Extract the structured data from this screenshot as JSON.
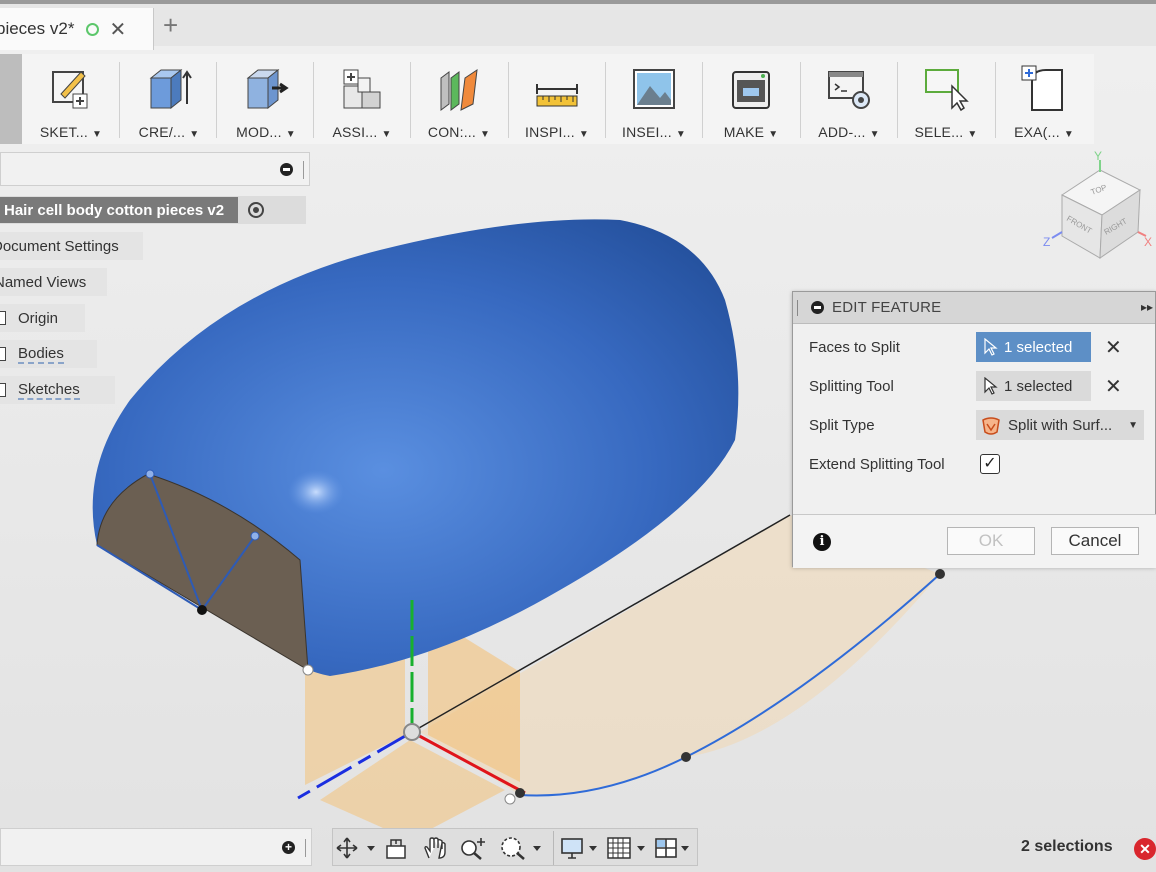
{
  "document_tab": {
    "title": "pieces v2*",
    "new_tab_icon": "plus-icon"
  },
  "toolbar": {
    "items": [
      {
        "label": "SKET...",
        "icon": "sketch-icon"
      },
      {
        "label": "CRE/...",
        "icon": "create-icon"
      },
      {
        "label": "MOD...",
        "icon": "modify-icon"
      },
      {
        "label": "ASSI...",
        "icon": "assemble-icon"
      },
      {
        "label": "CON:...",
        "icon": "construct-icon"
      },
      {
        "label": "INSPI...",
        "icon": "inspect-icon"
      },
      {
        "label": "INSEI...",
        "icon": "insert-icon"
      },
      {
        "label": "MAKE",
        "icon": "make-icon"
      },
      {
        "label": "ADD-...",
        "icon": "add-ins-icon"
      },
      {
        "label": "SELE...",
        "icon": "select-icon"
      },
      {
        "label": "EXA(...",
        "icon": "exact-icon"
      }
    ],
    "dropdown_glyph": "▼"
  },
  "browser": {
    "root": "Hair cell body cotton pieces v2",
    "items": [
      "Document Settings",
      "Named Views",
      "Origin",
      "Bodies",
      "Sketches"
    ]
  },
  "dialog": {
    "title": "EDIT FEATURE",
    "rows": {
      "faces_to_split": {
        "label": "Faces to Split",
        "value": "1 selected"
      },
      "splitting_tool": {
        "label": "Splitting Tool",
        "value": "1 selected"
      },
      "split_type": {
        "label": "Split Type",
        "value": "Split with Surf..."
      },
      "extend": {
        "label": "Extend Splitting Tool",
        "checked": true,
        "check_glyph": "✓"
      }
    },
    "clear_glyph": "✕",
    "info_glyph": "i",
    "ok_label": "OK",
    "cancel_label": "Cancel"
  },
  "viewcube": {
    "top": "TOP",
    "front": "FRONT",
    "right": "RIGHT",
    "axis_x": "X",
    "axis_y": "Y",
    "axis_z": "Z"
  },
  "status": {
    "selections": "2 selections",
    "clear_glyph": "✕"
  },
  "colors": {
    "accent": "#5d8fc6",
    "body_blue": "#3a6fc6",
    "plane_orange": "#f4c27a"
  }
}
